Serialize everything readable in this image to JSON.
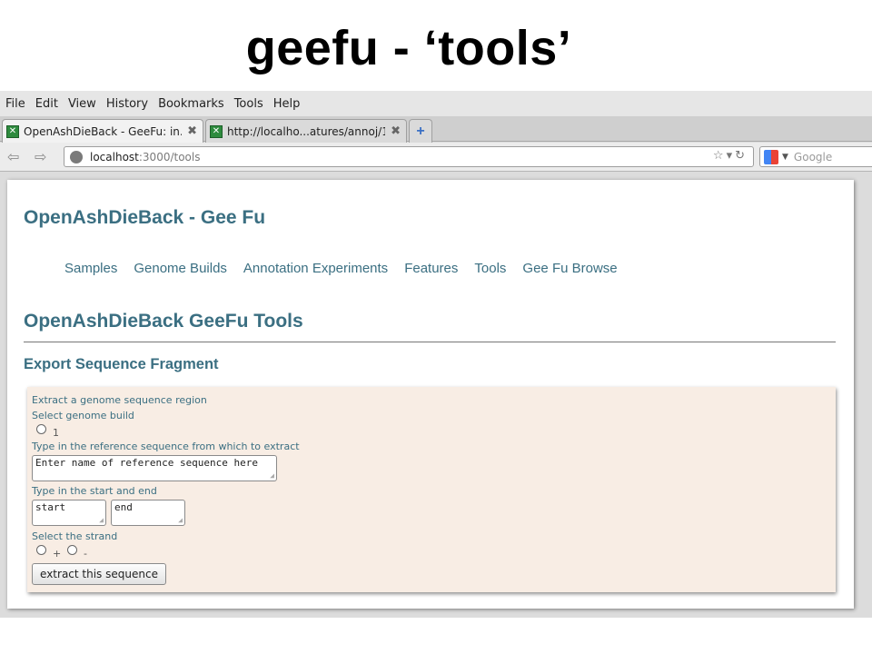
{
  "slide": {
    "title": "geefu - ‘tools’"
  },
  "menu": {
    "items": [
      "File",
      "Edit",
      "View",
      "History",
      "Bookmarks",
      "Tools",
      "Help"
    ]
  },
  "tabs": [
    {
      "label": "OpenAshDieBack - GeeFu: in...",
      "close": "✖"
    },
    {
      "label": "http://localho...atures/annoj/1",
      "close": "✖"
    }
  ],
  "new_tab": "+",
  "address_bar": {
    "host": "localhost",
    "path": ":3000/tools"
  },
  "search_box": {
    "placeholder": "Google"
  },
  "site": {
    "title": "OpenAshDieBack - Gee Fu",
    "nav": [
      "Samples",
      "Genome Builds",
      "Annotation Experiments",
      "Features",
      "Tools",
      "Gee Fu Browse"
    ]
  },
  "page": {
    "heading": "OpenAshDieBack GeeFu Tools",
    "section": "Export Sequence Fragment"
  },
  "form": {
    "intro": "Extract a genome sequence region",
    "genome_label": "Select genome build",
    "genome_option": "1",
    "ref_label": "Type in the reference sequence from which to extract",
    "ref_value": "Enter name of reference sequence here",
    "range_label": "Type in the start and end",
    "start_value": "start",
    "end_value": "end",
    "strand_label": "Select the strand",
    "strand_plus": "+",
    "strand_minus": "-",
    "submit": "extract this sequence"
  },
  "colors": {
    "accent": "#3b6f82",
    "panel": "#f8ede4"
  }
}
